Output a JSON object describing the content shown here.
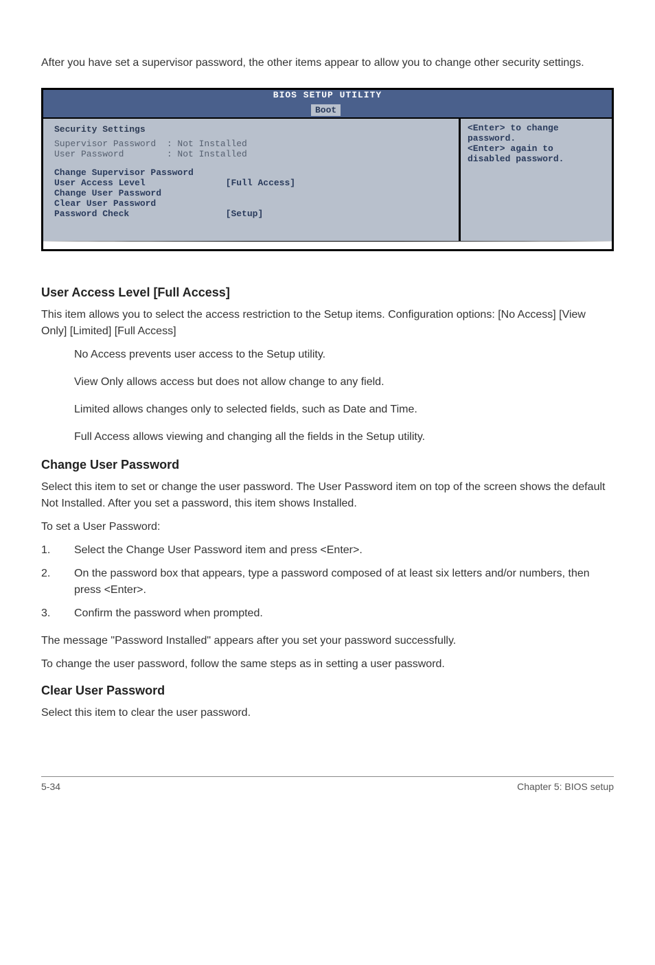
{
  "intro": "After you have set a supervisor password, the other items appear to allow you to change other security settings.",
  "bios": {
    "title": "BIOS SETUP UTILITY",
    "tab": "Boot",
    "left": {
      "heading": "Security Settings",
      "row_sup": "Supervisor Password  : Not Installed",
      "row_user": "User Password        : Not Installed",
      "entry_change_sup": "Change Supervisor Password",
      "entry_access_level_label": "User Access Level",
      "entry_access_level_value": "[Full Access]",
      "entry_change_user": "Change User Password",
      "entry_clear_user": "Clear User Password",
      "entry_pw_check_label": "Password Check",
      "entry_pw_check_value": "[Setup]"
    },
    "right": {
      "line1": "<Enter> to change",
      "line2": "password.",
      "line3": "<Enter> again to",
      "line4": "disabled password."
    }
  },
  "sec1": {
    "heading": "User Access Level [Full Access]",
    "p1": "This item allows you to select the access restriction to the Setup items. Configuration options: [No Access] [View Only] [Limited] [Full Access]",
    "bullets": {
      "b1": "No Access prevents user access to the Setup utility.",
      "b2": "View Only allows access but does not allow change to any field.",
      "b3": "Limited allows changes only to selected fields, such as Date and Time.",
      "b4": "Full Access allows viewing and changing all the fields in the Setup utility."
    }
  },
  "sec2": {
    "heading": "Change User Password",
    "p1": "Select this item to set or change the user password. The User Password item on top of the screen shows the default Not Installed. After you set a password, this item shows Installed.",
    "p2": "To set a User Password:",
    "steps": {
      "s1": "Select the Change User Password item and press <Enter>.",
      "s2": "On the password box that appears, type a password composed of at least six letters and/or numbers, then press <Enter>.",
      "s3": "Confirm the password when prompted."
    },
    "p3": "The message \"Password Installed\" appears after you set your password successfully.",
    "p4": "To change the user password, follow the same steps as in setting a user password."
  },
  "sec3": {
    "heading": "Clear User Password",
    "p1": "Select this item to clear the user password."
  },
  "footer": {
    "left": "5-34",
    "right": "Chapter 5: BIOS setup"
  }
}
